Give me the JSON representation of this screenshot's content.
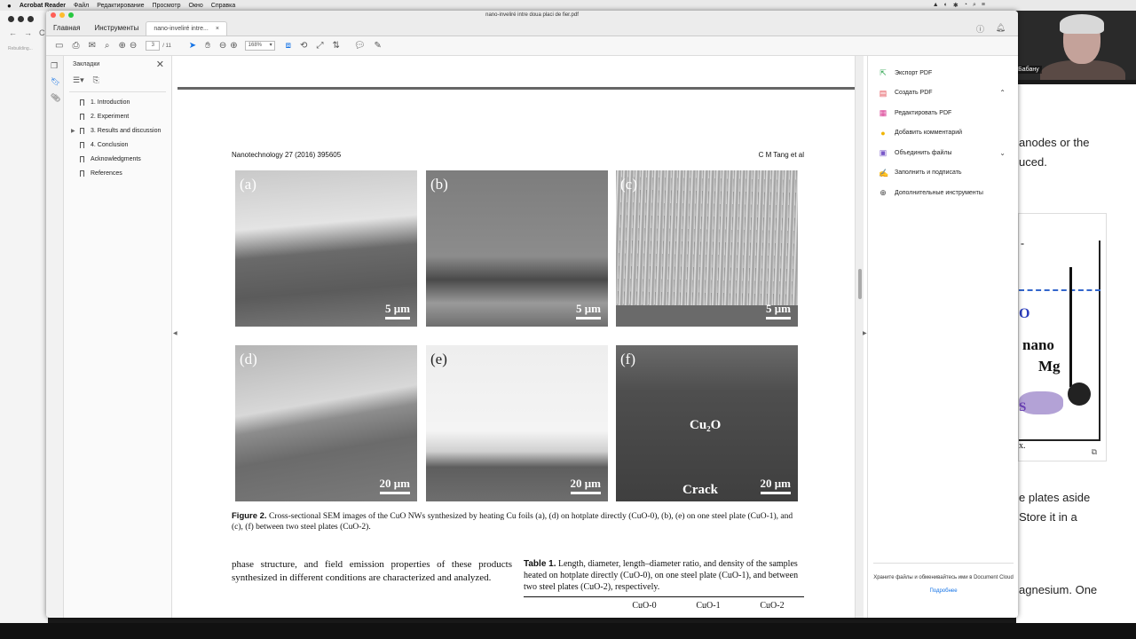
{
  "menubar": {
    "apple": "",
    "app": "Acrobat Reader",
    "items": [
      "Файл",
      "Редактирование",
      "Просмотр",
      "Окно",
      "Справка"
    ]
  },
  "browser": {
    "nav_back": "←",
    "nav_fwd": "→",
    "nav_reload": "C",
    "status": "Rebuilding..."
  },
  "webcam": {
    "name": "Радий Бабану"
  },
  "window": {
    "title": "nano-inveliré intre doua placi de fier.pdf",
    "tabs": {
      "home": "Главная",
      "tools": "Инструменты",
      "doc": "nano-inveliré intre...",
      "doc_close": "×"
    }
  },
  "toolbar": {
    "page_current": "3",
    "page_total": "/ 11",
    "zoom": "168%"
  },
  "bookmarks": {
    "header": "Закладки",
    "items": [
      {
        "label": "1. Introduction"
      },
      {
        "label": "2. Experiment"
      },
      {
        "label": "3. Results and discussion",
        "expandable": true
      },
      {
        "label": "4. Conclusion"
      },
      {
        "label": "Acknowledgments"
      },
      {
        "label": "References"
      }
    ]
  },
  "document": {
    "running_head_left": "Nanotechnology 27 (2016) 395605",
    "running_head_right": "C M Tang et al",
    "panels": [
      {
        "label": "(a)",
        "scale": "5 μm"
      },
      {
        "label": "(b)",
        "scale": "5 μm"
      },
      {
        "label": "(c)",
        "scale": "5 μm"
      },
      {
        "label": "(d)",
        "scale": "20 μm"
      },
      {
        "label": "(e)",
        "scale": "20 μm"
      },
      {
        "label": "(f)",
        "scale": "20 μm",
        "annot1": "Cu₂O",
        "annot2": "Crack"
      }
    ],
    "caption_bold": "Figure 2.",
    "caption_text": " Cross-sectional SEM images of the CuO NWs synthesized by heating Cu foils (a), (d) on hotplate directly (CuO-0), (b), (e) on one steel plate (CuO-1), and (c), (f) between two steel plates (CuO-2).",
    "body_text": "phase structure, and field emission properties of these products synthesized in different conditions are characterized and analyzed.",
    "table_caption_bold": "Table 1.",
    "table_caption_text": " Length, diameter, length–diameter ratio, and density of the samples heated on hotplate directly (CuO-0), on one steel plate (CuO-1), and between two steel plates (CuO-2), respectively.",
    "table_columns": [
      "CuO-0",
      "CuO-1",
      "CuO-2"
    ]
  },
  "right_panel": {
    "items": [
      {
        "label": "Экспорт PDF",
        "icon": "export-pdf-icon",
        "color": "#2da44e"
      },
      {
        "label": "Создать PDF",
        "icon": "create-pdf-icon",
        "color": "#e34850"
      },
      {
        "label": "Редактировать PDF",
        "icon": "edit-pdf-icon",
        "color": "#d83790"
      },
      {
        "label": "Добавить комментарий",
        "icon": "comment-icon",
        "color": "#f0b400"
      },
      {
        "label": "Объединить файлы",
        "icon": "combine-files-icon",
        "color": "#7a59c9"
      },
      {
        "label": "Заполнить и подписать",
        "icon": "sign-icon",
        "color": "#7a59c9"
      },
      {
        "label": "Дополнительные инструменты",
        "icon": "more-tools-icon",
        "color": "#444444"
      }
    ],
    "cloud_text": "Храните файлы и обменивайтесь ими в Document Cloud",
    "cloud_link": "Подробнее"
  },
  "background_doc": {
    "line1": "anodes or the",
    "line2": "uced.",
    "line3": "e plates aside",
    "line4": "Store it in a",
    "line5": "agnesium. One",
    "fig_o": "O",
    "fig_nano": "nano",
    "fig_mg": "Mg",
    "fig_s": "S",
    "fig_x": "x.",
    "fig_dash": "-"
  }
}
